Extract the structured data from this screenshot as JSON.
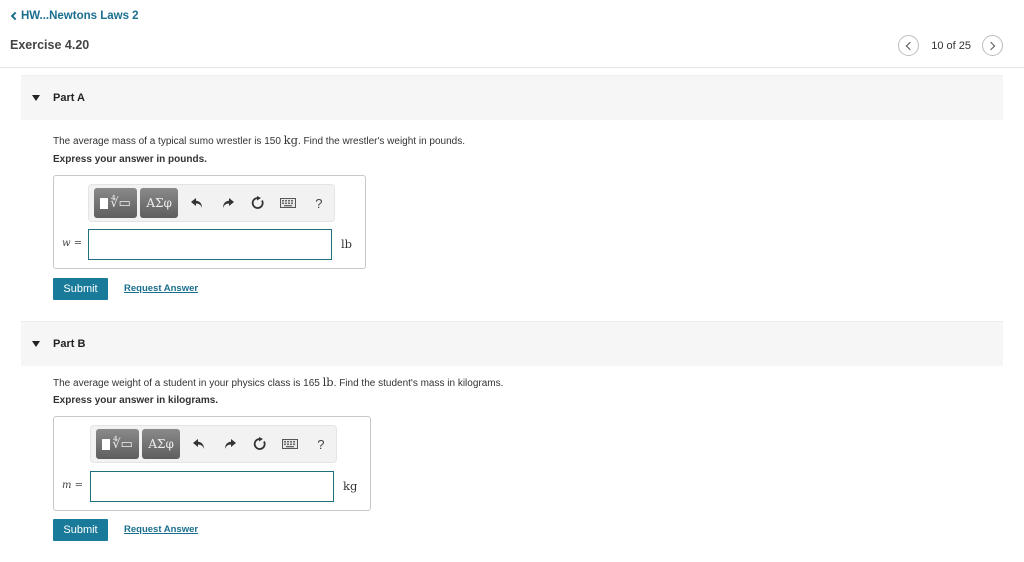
{
  "header": {
    "breadcrumb": "HW...Newtons Laws 2",
    "title": "Exercise 4.20",
    "pager": {
      "current": 10,
      "total": 25,
      "text": "10 of 25"
    }
  },
  "toolbar": {
    "items": [
      "templates-button",
      "greek-symbols-button",
      "undo-button",
      "redo-button",
      "reset-button",
      "keyboard-button",
      "help-button"
    ],
    "greek_label": "ΑΣφ",
    "help_label": "?"
  },
  "parts": [
    {
      "label": "Part A",
      "question_before": "The average mass of a typical sumo wrestler is 150 ",
      "question_unit": "kg",
      "question_after": ". Find the wrestler's weight in pounds.",
      "instruction": "Express your answer in pounds.",
      "variable": "w =",
      "input_value": "",
      "unit": "lb",
      "submit_label": "Submit",
      "request_label": "Request Answer"
    },
    {
      "label": "Part B",
      "question_before": "The average weight of a student in your physics class is 165 ",
      "question_unit": "lb",
      "question_after": ". Find the student's mass in kilograms.",
      "instruction": "Express your answer in kilograms.",
      "variable": "m =",
      "input_value": "",
      "unit": "kg",
      "submit_label": "Submit",
      "request_label": "Request Answer"
    }
  ]
}
